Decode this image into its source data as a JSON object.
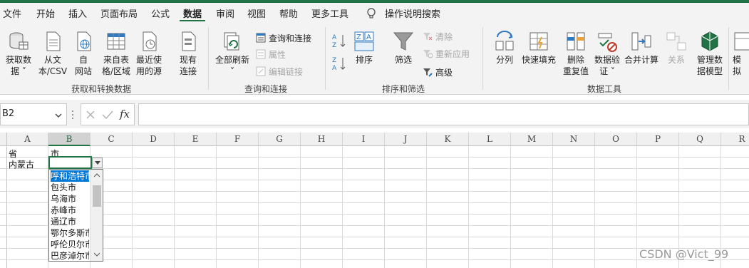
{
  "menu": {
    "tabs": [
      {
        "label": "文件"
      },
      {
        "label": "开始"
      },
      {
        "label": "插入"
      },
      {
        "label": "页面布局"
      },
      {
        "label": "公式"
      },
      {
        "label": "数据"
      },
      {
        "label": "审阅"
      },
      {
        "label": "视图"
      },
      {
        "label": "帮助"
      },
      {
        "label": "更多工具"
      }
    ],
    "tell_me": "操作说明搜索",
    "active_tab": "数据",
    "accent_color": "#217346"
  },
  "ribbon": {
    "groups": {
      "get_transform": {
        "label": "获取和转换数据",
        "get_data": "获取数\n据 ˅",
        "from_text_csv": "从文\n本/CSV",
        "from_web": "自\n网站",
        "from_table": "来自表\n格/区域",
        "recent_sources": "最近使\n用的源",
        "existing_connections": "现有\n连接"
      },
      "queries": {
        "label": "查询和连接",
        "refresh_all": "全部刷新",
        "queries_connections": "查询和连接",
        "properties": "属性",
        "edit_links": "编辑链接"
      },
      "sort_filter": {
        "label": "排序和筛选",
        "sort": "排序",
        "filter": "筛选",
        "clear": "清除",
        "reapply": "重新应用",
        "advanced": "高级"
      },
      "data_tools": {
        "label": "数据工具",
        "text_to_columns": "分列",
        "flash_fill": "快速填充",
        "remove_duplicates": "删除\n重复值",
        "data_validation": "数据验\n证 ˅",
        "consolidate": "合并计算",
        "relationships": "关系",
        "manage_model": "管理数\n据模型"
      },
      "forecast": {
        "what_if": "模拟"
      }
    }
  },
  "formula_bar": {
    "name_box": "B2",
    "fx": "fx",
    "formula": ""
  },
  "sheet": {
    "columns": [
      "A",
      "B",
      "C",
      "D",
      "E",
      "F",
      "G",
      "H",
      "I",
      "J",
      "K",
      "L",
      "M",
      "N",
      "O",
      "P",
      "Q",
      "R"
    ],
    "selected_column": "B",
    "cells": {
      "A1": "省",
      "B1": "市",
      "A2": "内蒙古"
    }
  },
  "dropdown": {
    "items": [
      "呼和浩特市",
      "包头市",
      "乌海市",
      "赤峰市",
      "通辽市",
      "鄂尔多斯市",
      "呼伦贝尔市",
      "巴彦淖尔市"
    ],
    "selected_index": 0
  },
  "watermark": "CSDN @Vict_99"
}
